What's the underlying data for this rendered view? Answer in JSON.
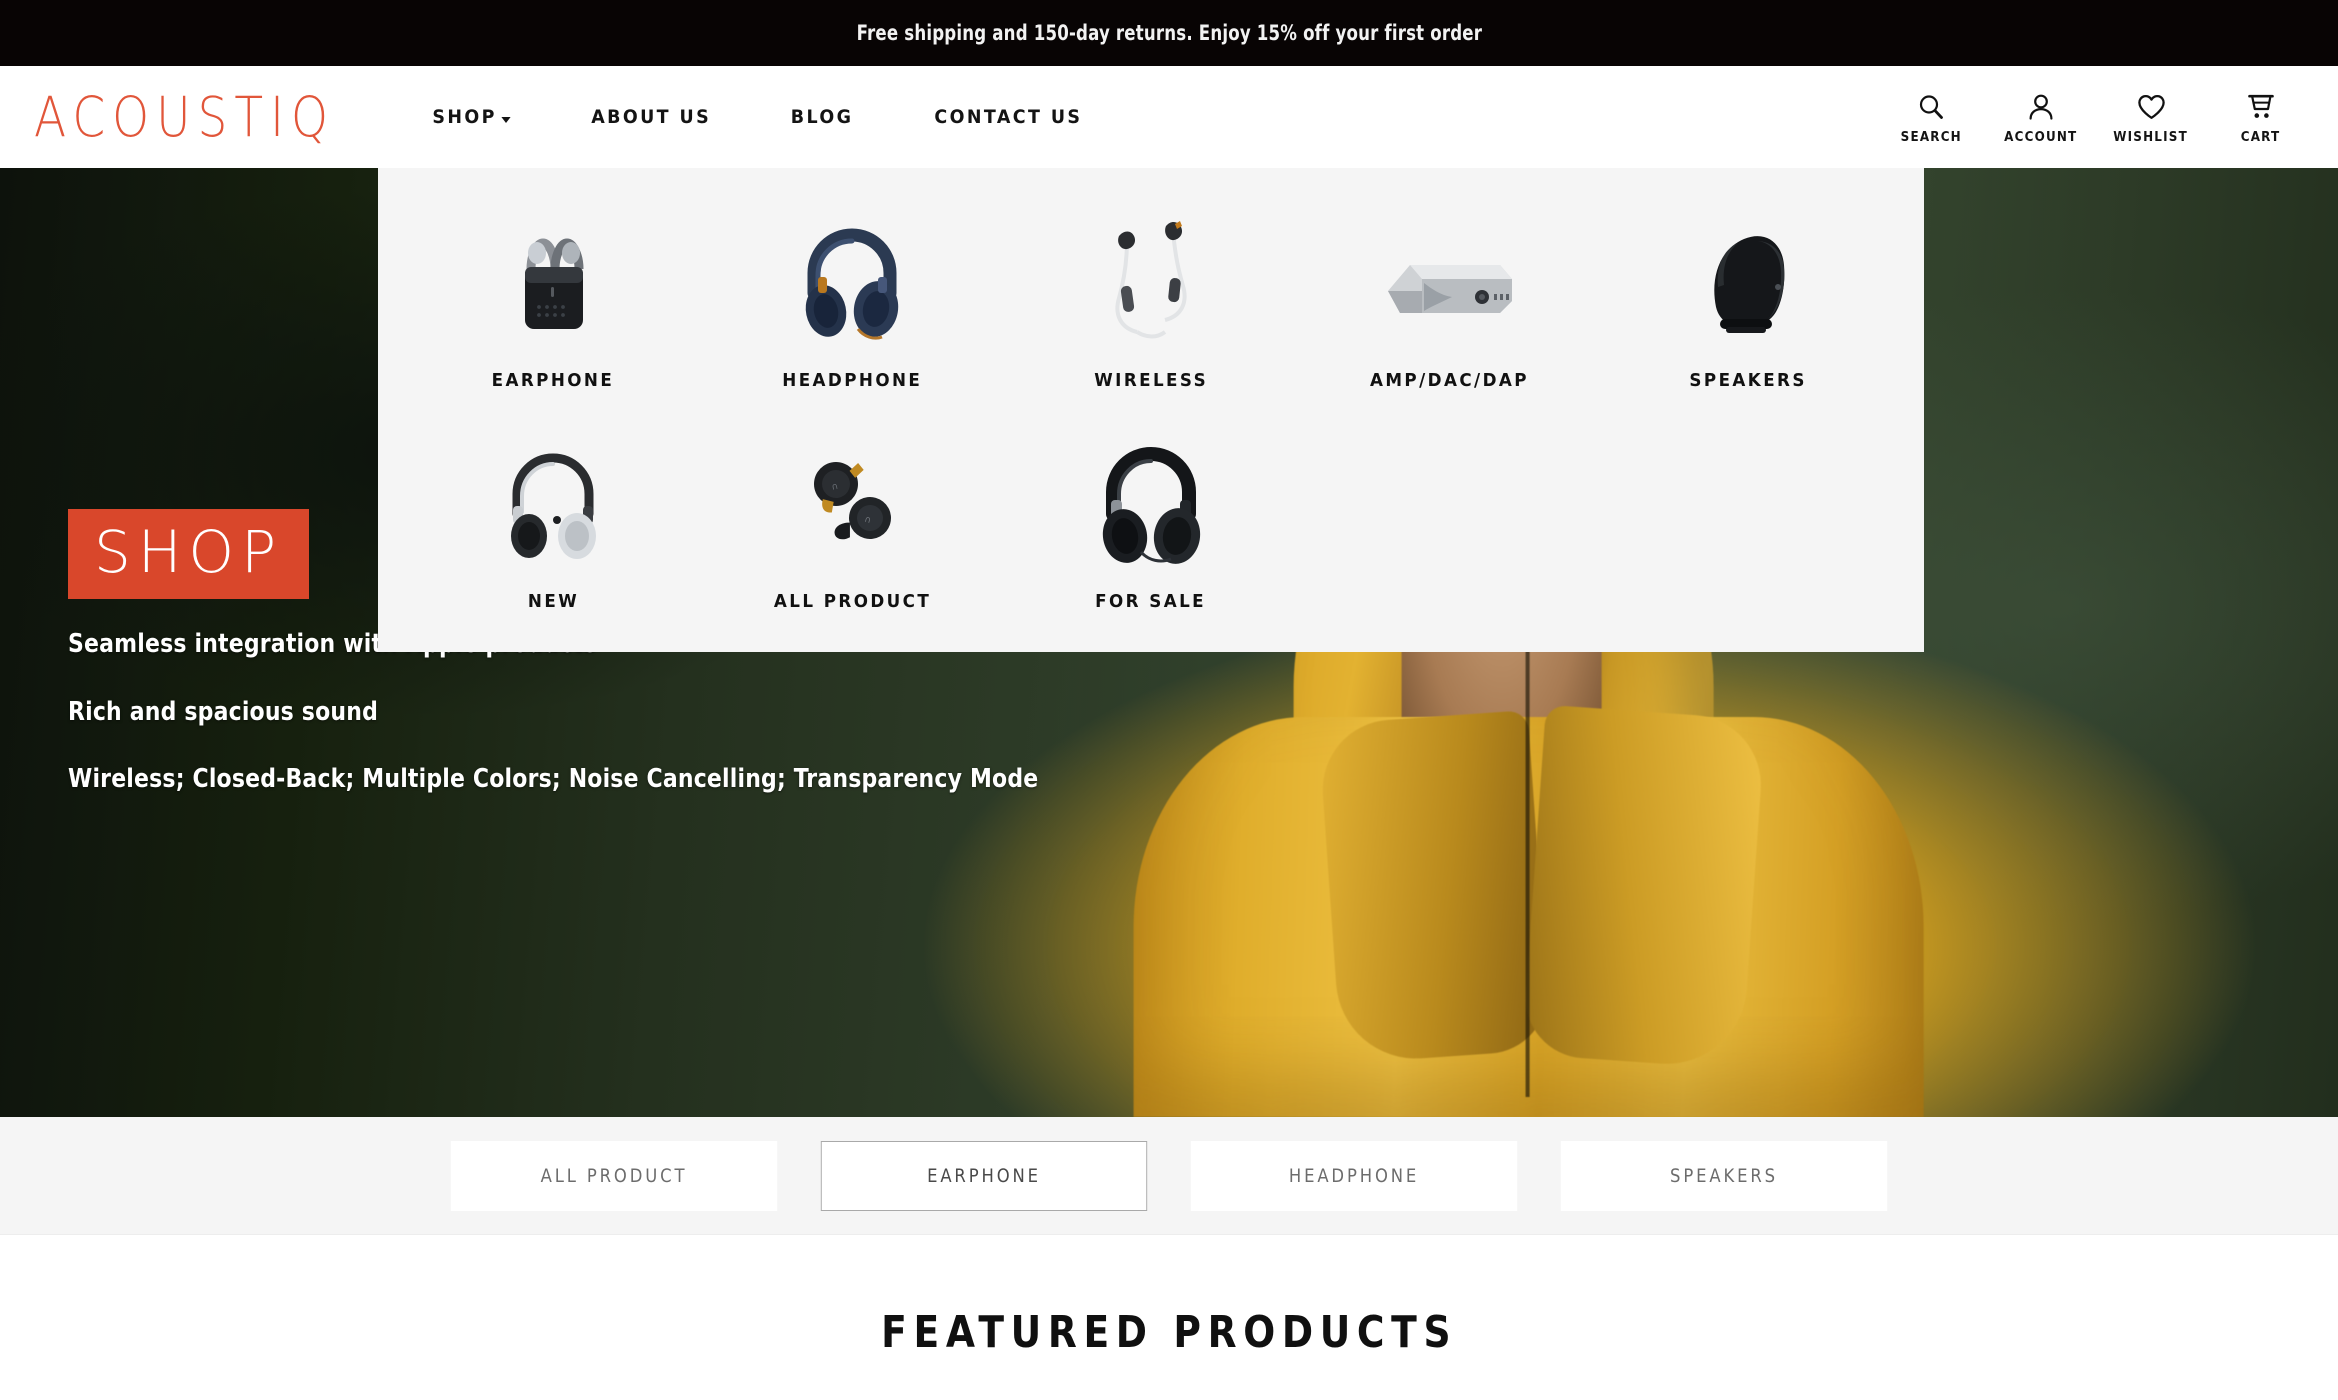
{
  "announcement": {
    "text": "Free shipping and 150-day returns. Enjoy 15% off your first order"
  },
  "brand": {
    "name": "ACOUSTIQ",
    "accent_color": "#e1563a"
  },
  "nav": {
    "items": [
      {
        "label": "SHOP",
        "has_caret": true
      },
      {
        "label": "ABOUT US",
        "has_caret": false
      },
      {
        "label": "BLOG",
        "has_caret": false
      },
      {
        "label": "CONTACT US",
        "has_caret": false
      }
    ]
  },
  "header_actions": [
    {
      "label": "SEARCH",
      "icon": "search-icon"
    },
    {
      "label": "ACCOUNT",
      "icon": "account-icon"
    },
    {
      "label": "WISHLIST",
      "icon": "heart-icon"
    },
    {
      "label": "CART",
      "icon": "cart-icon"
    }
  ],
  "mega_menu": {
    "row1": [
      {
        "label": "EARPHONE",
        "icon": "earbuds-case-icon"
      },
      {
        "label": "HEADPHONE",
        "icon": "navy-headphone-icon"
      },
      {
        "label": "WIRELESS",
        "icon": "neckband-earphone-icon"
      },
      {
        "label": "AMP/DAC/DAP",
        "icon": "amplifier-icon"
      },
      {
        "label": "SPEAKERS",
        "icon": "speaker-icon"
      }
    ],
    "row2": [
      {
        "label": "NEW",
        "icon": "silver-onear-headphone-icon"
      },
      {
        "label": "ALL PRODUCT",
        "icon": "true-wireless-earbuds-icon"
      },
      {
        "label": "FOR SALE",
        "icon": "black-overear-headphone-icon"
      }
    ]
  },
  "hero": {
    "badge": "SHOP",
    "badge_color": "#d9472b",
    "lines": [
      "Seamless integration with Apple products",
      "Rich and spacious sound",
      "Wireless; Closed-Back; Multiple Colors; Noise Cancelling; Transparency Mode"
    ]
  },
  "filter_tabs": [
    {
      "label": "ALL PRODUCT",
      "active": false
    },
    {
      "label": "EARPHONE",
      "active": true
    },
    {
      "label": "HEADPHONE",
      "active": false
    },
    {
      "label": "SPEAKERS",
      "active": false
    }
  ],
  "featured": {
    "title": "FEATURED PRODUCTS"
  }
}
